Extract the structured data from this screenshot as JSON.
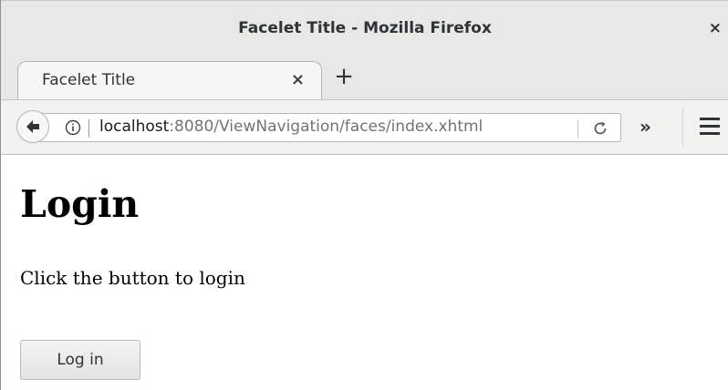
{
  "window": {
    "title": "Facelet Title - Mozilla Firefox",
    "close_glyph": "×"
  },
  "tabs": [
    {
      "label": "Facelet Title",
      "close_glyph": "×",
      "active": true
    }
  ],
  "new_tab_glyph": "+",
  "navbar": {
    "url_host": "localhost",
    "url_rest": ":8080/ViewNavigation/faces/index.xhtml",
    "overflow_glyph": "»",
    "icons": [
      "back-arrow-icon",
      "info-icon",
      "reload-icon",
      "hamburger-menu-icon"
    ]
  },
  "page": {
    "heading": "Login",
    "text": "Click the button to login",
    "button_label": "Log in"
  },
  "colors": {
    "chrome_background": "#e8e8e7",
    "text": "#2e3436",
    "url_host": "#1a1a1a",
    "url_rest": "#737373"
  }
}
